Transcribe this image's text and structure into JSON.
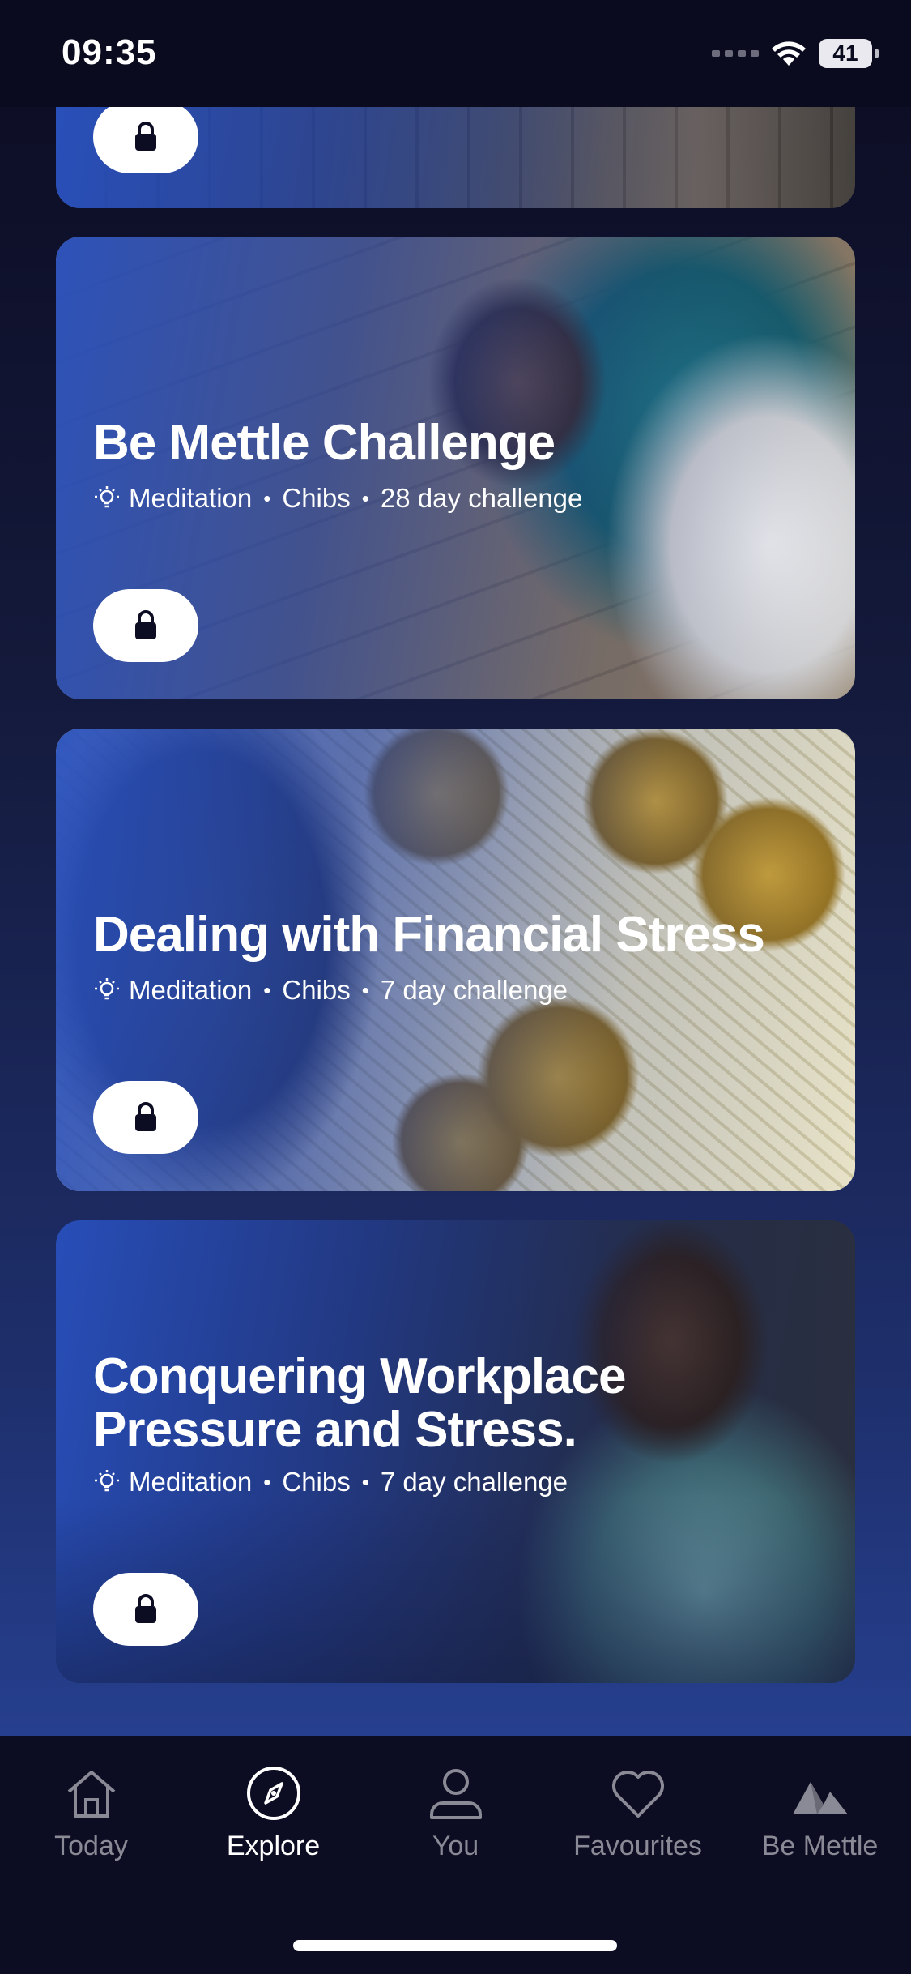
{
  "status_bar": {
    "time": "09:35",
    "battery": "41"
  },
  "cards": [
    {
      "title": "",
      "type": "",
      "author": "",
      "duration": "",
      "locked": true
    },
    {
      "title": "Be Mettle Challenge",
      "type": "Meditation",
      "author": "Chibs",
      "duration": "28 day challenge",
      "locked": true
    },
    {
      "title": "Dealing with Financial Stress",
      "type": "Meditation",
      "author": "Chibs",
      "duration": "7 day challenge",
      "locked": true
    },
    {
      "title_line1": "Conquering Workplace",
      "title_line2": "Pressure and Stress.",
      "type": "Meditation",
      "author": "Chibs",
      "duration": "7 day challenge",
      "locked": true
    }
  ],
  "meta_separator": "•",
  "tabs": [
    {
      "label": "Today",
      "icon": "home-icon",
      "active": false
    },
    {
      "label": "Explore",
      "icon": "compass-icon",
      "active": true
    },
    {
      "label": "You",
      "icon": "person-icon",
      "active": false
    },
    {
      "label": "Favourites",
      "icon": "heart-icon",
      "active": false
    },
    {
      "label": "Be Mettle",
      "icon": "mountain-icon",
      "active": false
    }
  ],
  "colors": {
    "background_top": "#0c0c22",
    "background_bottom": "#2b4aa5",
    "card_accent": "#2850be",
    "tab_active": "#ffffff",
    "tab_inactive": "#8a8a96"
  }
}
